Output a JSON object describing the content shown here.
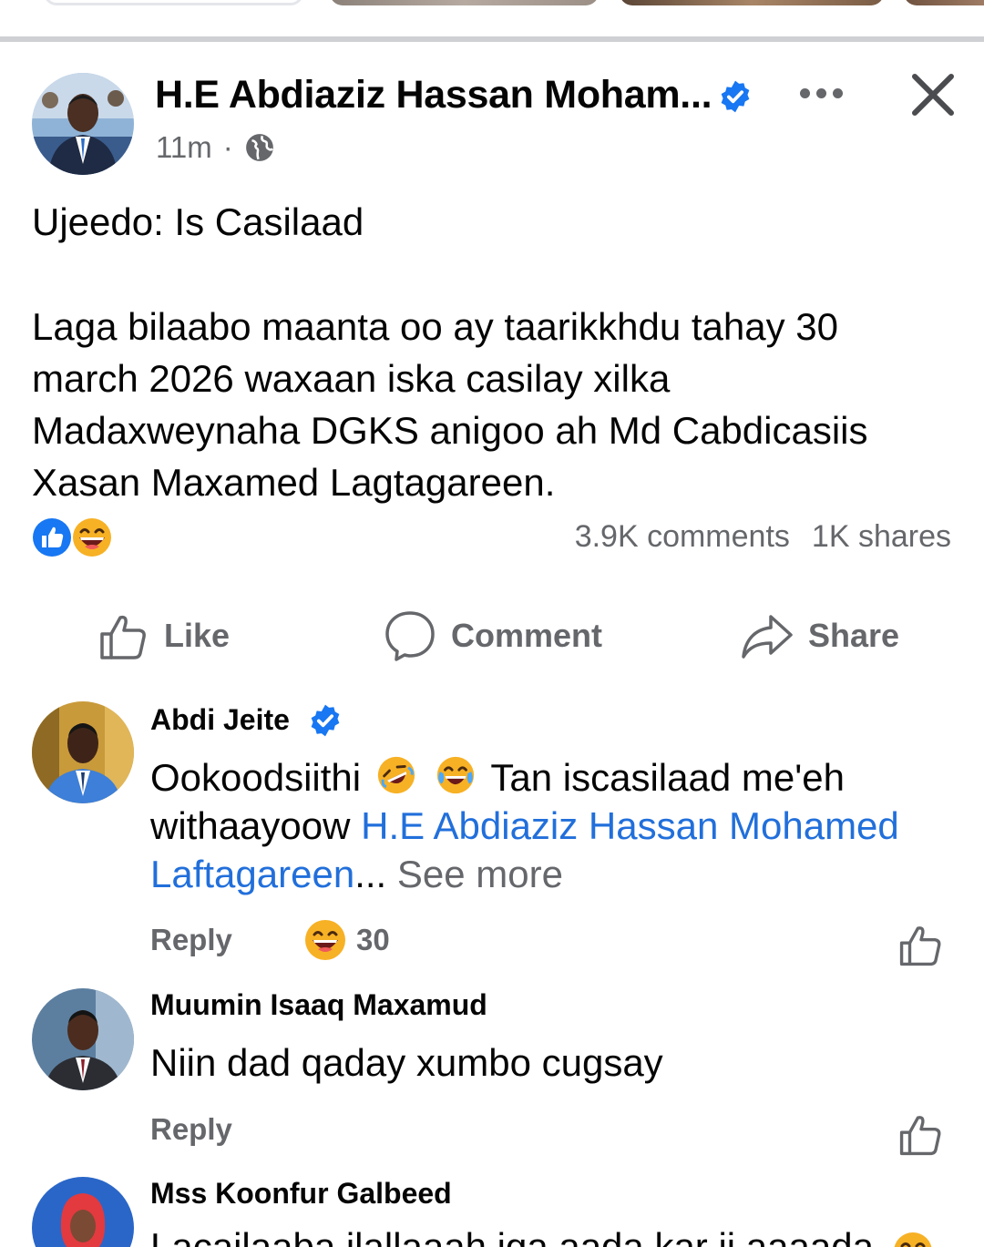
{
  "post": {
    "author": "H.E Abdiaziz Hassan Moham...",
    "time": "11m",
    "separator": "·",
    "subject": "Ujeedo: Is Casilaad",
    "body": "Laga bilaabo maanta oo ay taarikkhdu tahay 30\nmarch 2026 waxaan iska casilay xilka\nMadaxweynaha DGKS anigoo ah Md Cabdicasiis\nXasan Maxamed Lagtagareen.",
    "reactions": [
      "like-icon",
      "laugh-icon"
    ],
    "comments_count": "3.9K comments",
    "shares_count": "1K shares"
  },
  "actions": {
    "like": "Like",
    "comment": "Comment",
    "share": "Share"
  },
  "comments": [
    {
      "name": "Abdi Jeite",
      "verified": true,
      "text_before": "Ookoodsiithi",
      "text_after": "Tan iscasilaad me'eh withaayoow",
      "mention": "H.E Abdiaziz Hassan Mohamed Laftagareen",
      "ellipsis": "...",
      "see_more": "See more",
      "reply": "Reply",
      "reaction_count": "30"
    },
    {
      "name": "Muumin Isaaq Maxamud",
      "text": "Niin dad qaday xumbo cugsay",
      "reply": "Reply"
    },
    {
      "name": "Mss Koonfur Galbeed",
      "text": "Lacailaaba ilallaaah iga aada kar ii aaaada"
    }
  ],
  "colors": {
    "accent_blue": "#1877f2",
    "mention_blue": "#216fdb",
    "secondary_text": "#65676b",
    "divider": "#ced0d4"
  }
}
